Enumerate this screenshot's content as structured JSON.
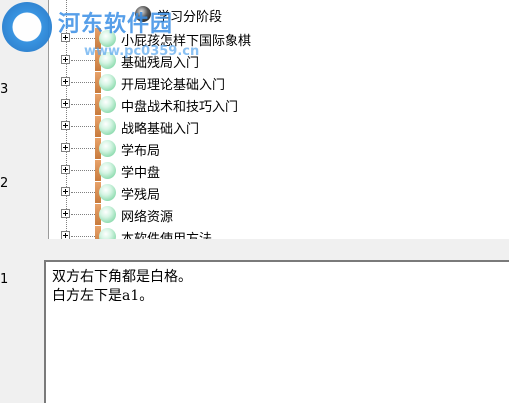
{
  "row_numbers": [
    "3",
    "2",
    "1"
  ],
  "tree": {
    "items": [
      {
        "label": "学习分阶段",
        "icon": "dark-orb-icon"
      },
      {
        "label": "小屁孩怎样下国际象棋",
        "icon": "book-orb-icon"
      },
      {
        "label": "基础残局入门",
        "icon": "book-orb-icon"
      },
      {
        "label": "开局理论基础入门",
        "icon": "book-orb-icon"
      },
      {
        "label": "中盘战术和技巧入门",
        "icon": "book-orb-icon"
      },
      {
        "label": "战略基础入门",
        "icon": "book-orb-icon"
      },
      {
        "label": "学布局",
        "icon": "book-orb-icon"
      },
      {
        "label": "学中盘",
        "icon": "book-orb-icon"
      },
      {
        "label": "学残局",
        "icon": "book-orb-icon"
      },
      {
        "label": "网络资源",
        "icon": "book-orb-icon"
      },
      {
        "label": "本软件使用方法",
        "icon": "book-orb-icon"
      }
    ]
  },
  "editor": {
    "lines": [
      "双方右下角都是白格。",
      "白方左下是a1。"
    ]
  },
  "watermark": {
    "title": "河东软件园",
    "url": "www.pc0359.cn"
  },
  "colors": {
    "watermark_blue": "#3a8fe6",
    "orb_green": "#8fdcb0",
    "book_spine": "#c77a3c"
  }
}
